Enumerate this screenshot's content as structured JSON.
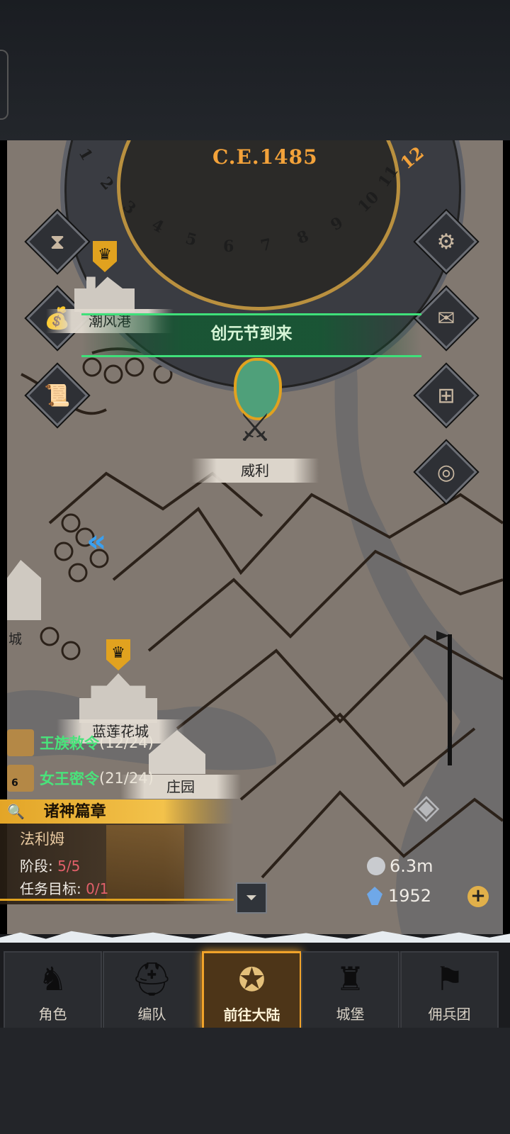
{
  "calendar": {
    "year": "C.E.1485",
    "months": [
      "1",
      "2",
      "3",
      "4",
      "5",
      "6",
      "7",
      "8",
      "9",
      "10",
      "11"
    ],
    "current_month": "12"
  },
  "map": {
    "towns": [
      {
        "name": "潮风港"
      },
      {
        "name": "威利"
      },
      {
        "name": "蓝莲花城"
      },
      {
        "name": "庄园"
      },
      {
        "name": "城"
      }
    ],
    "event_banner": "创元节到来"
  },
  "left_buttons": [
    "hourglass-icon",
    "money-bag-icon",
    "scroll-icon"
  ],
  "right_buttons": [
    "gear-icon",
    "mail-icon",
    "grid-icon",
    "coin-icon"
  ],
  "quests": [
    {
      "name": "王族敕令",
      "progress": "(12/24)"
    },
    {
      "name": "女王密令",
      "progress": "(21/24)",
      "badge": "6"
    }
  ],
  "chapter": {
    "title": "诸神篇章",
    "hero": "法利姆",
    "stage_label": "阶段: ",
    "stage_value": "5/5",
    "goal_label": "任务目标: ",
    "goal_value": "0/1"
  },
  "resources": {
    "silver": "6.3m",
    "crystal": "1952"
  },
  "tabs": [
    {
      "label": "角色",
      "icon": "knight-icon"
    },
    {
      "label": "编队",
      "icon": "helmet-icon"
    },
    {
      "label": "前往大陆",
      "icon": "compass-icon",
      "active": true
    },
    {
      "label": "城堡",
      "icon": "castle-icon"
    },
    {
      "label": "佣兵团",
      "icon": "mercenary-icon"
    }
  ],
  "colors": {
    "accent": "#f1a32a",
    "quest_green": "#49e37b",
    "banner_green": "#3fe07a",
    "stage_red": "#e2606a"
  }
}
